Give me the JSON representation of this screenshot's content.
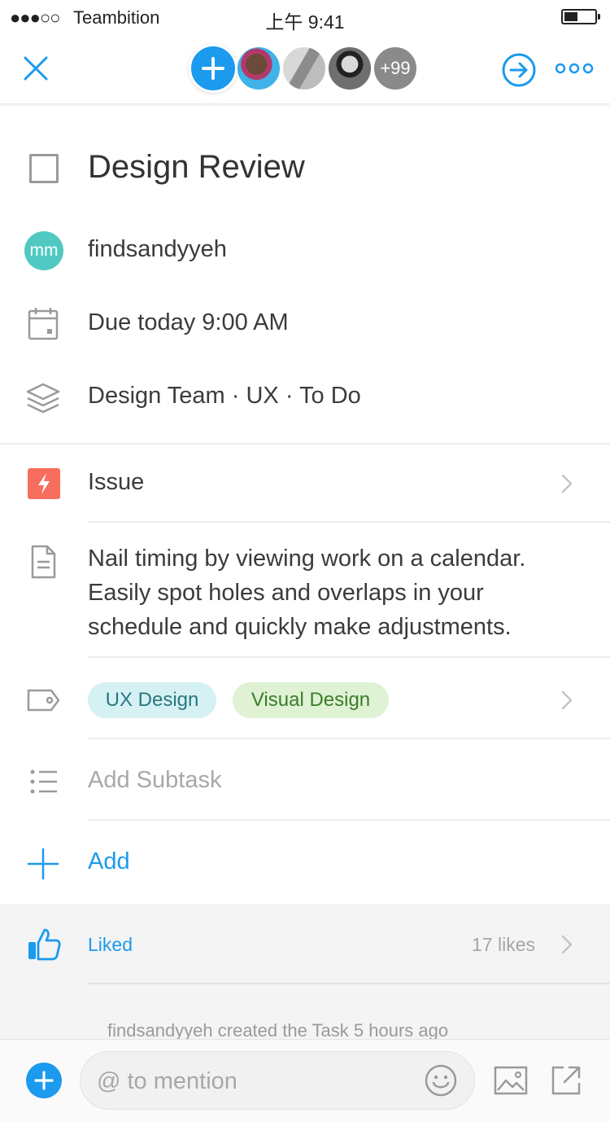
{
  "status_bar": {
    "signal": "●●●○○",
    "carrier": "Teambition",
    "time": "上午 9:41"
  },
  "header": {
    "close_icon": "close-icon",
    "more_members": "+99",
    "move_icon": "arrow-right-circle-icon",
    "more_icon": "more-dots-icon"
  },
  "task": {
    "title": "Design Review",
    "assignee": {
      "initials": "mm",
      "name": "findsandyyeh"
    },
    "due": "Due today 9:00 AM",
    "location": "Design Team · UX · To Do",
    "type": "Issue",
    "description": "Nail timing by viewing work on a calendar. Easily spot holes and overlaps in your schedule and quickly make adjustments.",
    "tags": [
      {
        "label": "UX Design",
        "color": "#d6f1f3"
      },
      {
        "label": "Visual Design",
        "color": "#dff2d4"
      }
    ],
    "subtask_placeholder": "Add Subtask",
    "add_label": "Add"
  },
  "likes": {
    "label": "Liked",
    "count": "17 likes"
  },
  "activity": {
    "text": "findsandyyeh created the Task 5 hours ago"
  },
  "comment": {
    "placeholder": "@ to mention"
  },
  "colors": {
    "accent": "#1b9aee",
    "issue": "#f76d5e",
    "assignee_avatar": "#4fc9c1"
  }
}
